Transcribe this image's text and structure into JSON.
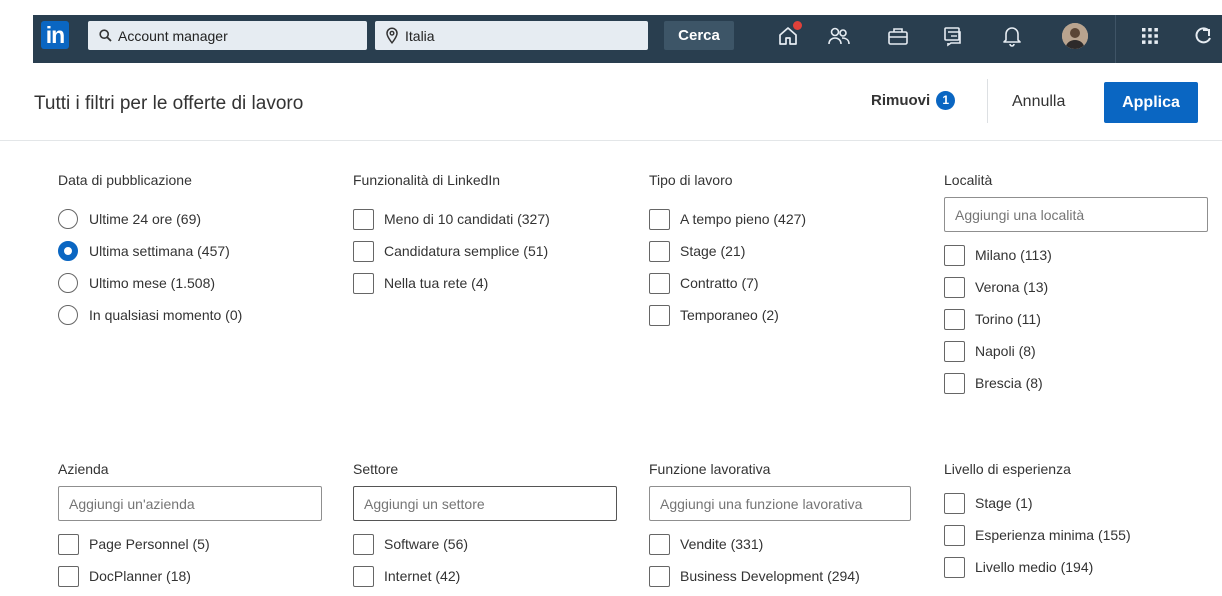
{
  "nav": {
    "logo_text": "in",
    "search_keyword": "Account manager",
    "search_location": "Italia",
    "search_button": "Cerca",
    "icons": [
      "home-icon",
      "network-icon",
      "jobs-icon",
      "messaging-icon",
      "notifications-icon",
      "avatar",
      "apps-grid-icon",
      "premium-icon"
    ]
  },
  "header": {
    "title": "Tutti i filtri per le offerte di lavoro",
    "remove_label": "Rimuovi",
    "remove_count": "1",
    "cancel_label": "Annulla",
    "apply_label": "Applica"
  },
  "filters": {
    "date": {
      "title": "Data di pubblicazione",
      "options": [
        "Ultime 24 ore (69)",
        "Ultima settimana (457)",
        "Ultimo mese (1.508)",
        "In qualsiasi momento (0)"
      ],
      "selected": "Ultima settimana (457)"
    },
    "linkedin_features": {
      "title": "Funzionalità di LinkedIn",
      "options": [
        "Meno di 10 candidati (327)",
        "Candidatura semplice (51)",
        "Nella tua rete (4)"
      ]
    },
    "job_type": {
      "title": "Tipo di lavoro",
      "options": [
        "A tempo pieno (427)",
        "Stage (21)",
        "Contratto (7)",
        "Temporaneo (2)"
      ]
    },
    "location": {
      "title": "Località",
      "placeholder": "Aggiungi una località",
      "options": [
        "Milano (113)",
        "Verona (13)",
        "Torino (11)",
        "Napoli (8)",
        "Brescia (8)"
      ]
    },
    "company": {
      "title": "Azienda",
      "placeholder": "Aggiungi un'azienda",
      "options": [
        "Page Personnel (5)",
        "DocPlanner (18)"
      ]
    },
    "industry": {
      "title": "Settore",
      "placeholder": "Aggiungi un settore",
      "options": [
        "Software (56)",
        "Internet (42)"
      ]
    },
    "job_function": {
      "title": "Funzione lavorativa",
      "placeholder": "Aggiungi una funzione lavorativa",
      "options": [
        "Vendite (331)",
        "Business Development (294)"
      ]
    },
    "experience": {
      "title": "Livello di esperienza",
      "options": [
        "Stage (1)",
        "Esperienza minima (155)",
        "Livello medio (194)"
      ]
    }
  },
  "colors": {
    "nav_bg": "#293e4f",
    "accent": "#0a66c2",
    "badge": "#e0413a"
  }
}
